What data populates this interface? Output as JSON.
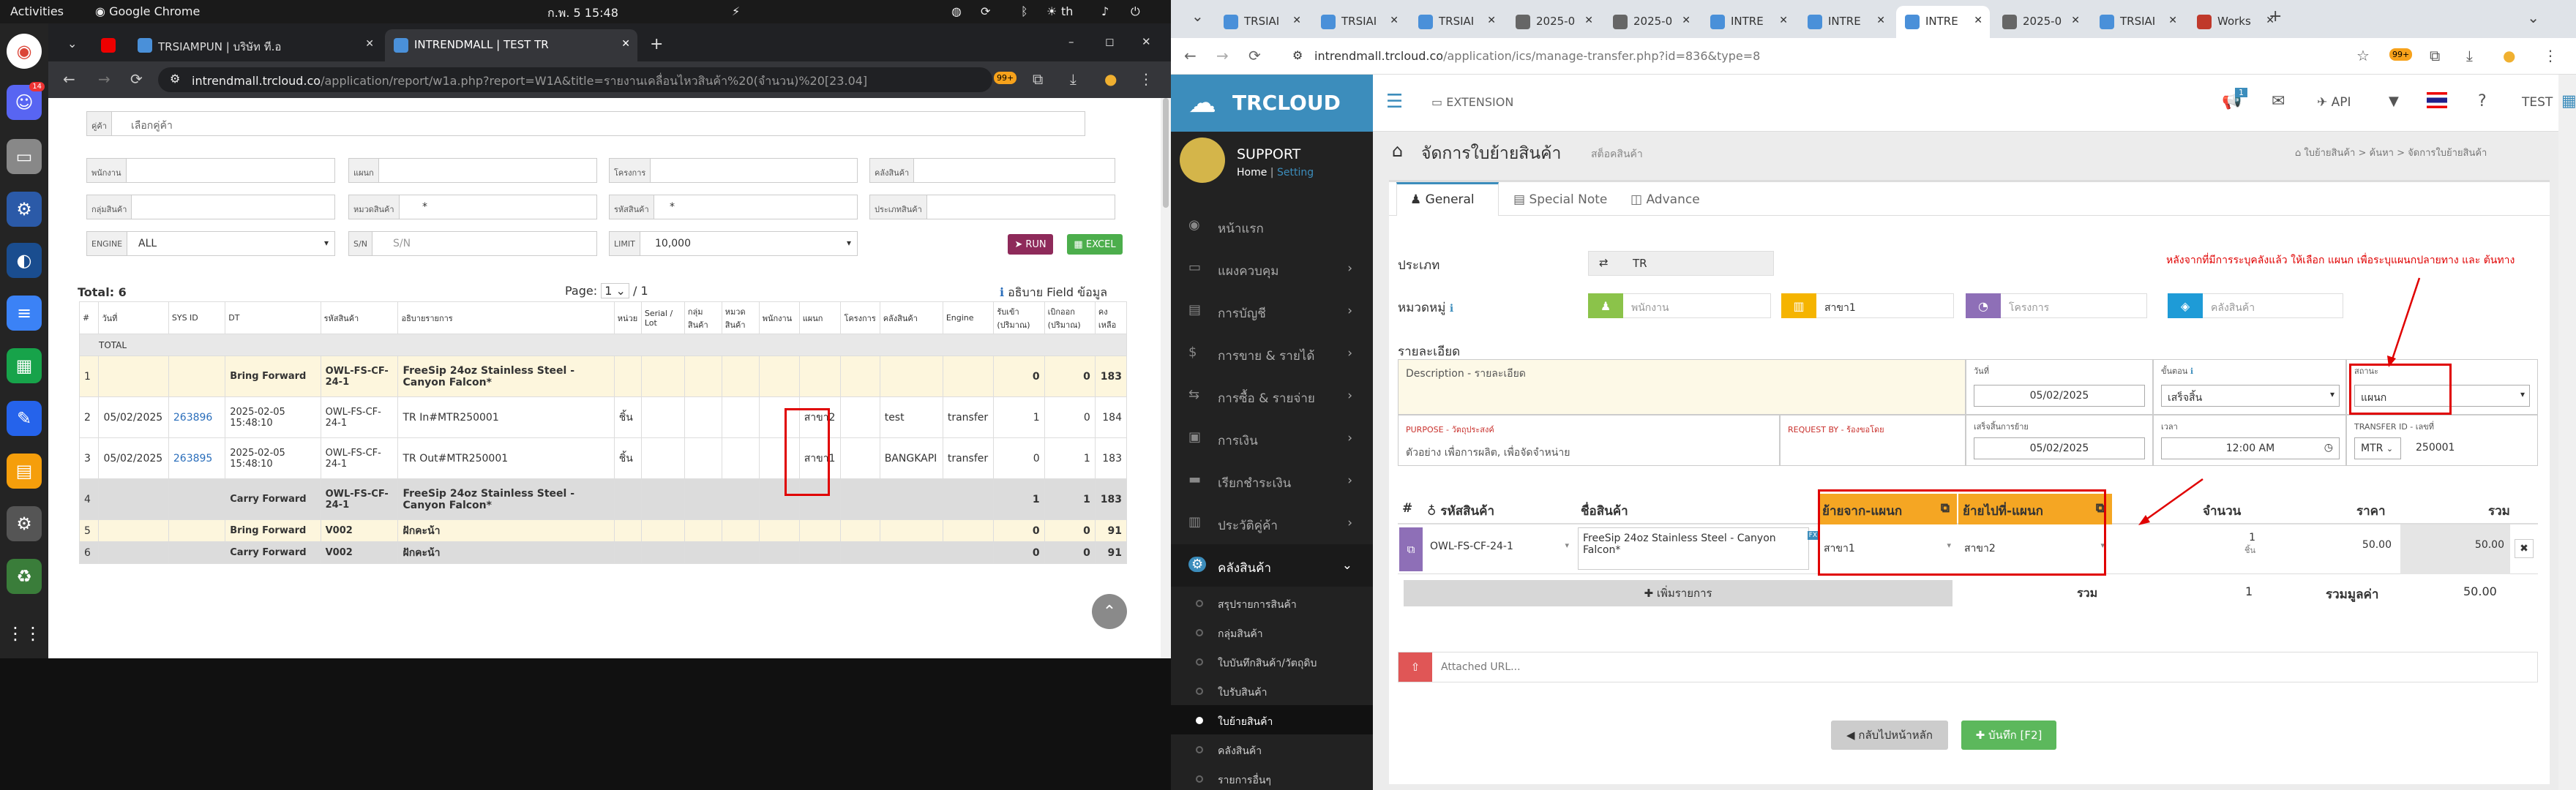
{
  "system": {
    "activities": "Activities",
    "app": "Google Chrome",
    "clock": "ก.พ. 5  15:48",
    "lang": "th",
    "dock_badge": "14"
  },
  "left": {
    "tabs": [
      {
        "label": "TRSIAMPUN | บริษัท ที.อ"
      },
      {
        "label": "INTRENDMALL | TEST TR"
      }
    ],
    "url_host": "intrendmall.trcloud.co",
    "url_path": "/application/report/w1a.php?report=W1A&title=รายงานเคลื่อนไหวสินค้า%20(จำนวน)%20[23.04]",
    "ext_badge": "99+",
    "filters": {
      "customer_label": "คู่ค้า",
      "customer_placeholder": "เลือกคู่ค้า",
      "employee": "พนักงาน",
      "department": "แผนก",
      "project": "โครงการ",
      "warehouse": "คลังสินค้า",
      "product_group": "กลุ่มสินค้า",
      "category": "หมวดสินค้า",
      "category_value": "*",
      "product_code": "รหัสสินค้า",
      "product_code_value": "*",
      "product_type": "ประเภทสินค้า",
      "engine_label": "ENGINE",
      "engine_value": "ALL",
      "sn_label": "S/N",
      "sn_placeholder": "S/N",
      "limit_label": "LIMIT",
      "limit_value": "10,000",
      "run": "RUN",
      "excel": "EXCEL"
    },
    "total": "Total: 6",
    "page_label": "Page:",
    "page_value": "1",
    "page_of": "/ 1",
    "field_desc": "อธิบาย Field ข้อมูล",
    "headers": [
      "#",
      "วันที่",
      "SYS ID",
      "DT",
      "รหัสสินค้า",
      "อธิบายรายการ",
      "หน่วย",
      "Serial / Lot",
      "กลุ่ม สินค้า",
      "หมวด สินค้า",
      "พนักงาน",
      "แผนก",
      "โครงการ",
      "คลังสินค้า",
      "Engine",
      "รับเข้า (ปริมาณ)",
      "เบิกออก (ปริมาณ)",
      "คง เหลือ"
    ],
    "total_row": "TOTAL",
    "rows": [
      {
        "n": "1",
        "date": "",
        "sys": "",
        "dt": "Bring Forward",
        "code": "OWL-FS-CF-24-1",
        "desc": "FreeSip 24oz Stainless Steel - Canyon Falcon*",
        "unit": "",
        "dept": "",
        "wh": "",
        "eng": "",
        "in": "0",
        "out": "0",
        "bal": "183",
        "style": "bf"
      },
      {
        "n": "2",
        "date": "05/02/2025",
        "sys": "263896",
        "dt": "2025-02-05 15:48:10",
        "code": "OWL-FS-CF-24-1",
        "desc": "TR In#MTR250001",
        "unit": "ชิ้น",
        "dept": "สาขา2",
        "wh": "test",
        "eng": "transfer",
        "in": "1",
        "out": "0",
        "bal": "184",
        "style": "n"
      },
      {
        "n": "3",
        "date": "05/02/2025",
        "sys": "263895",
        "dt": "2025-02-05 15:48:10",
        "code": "OWL-FS-CF-24-1",
        "desc": "TR Out#MTR250001",
        "unit": "ชิ้น",
        "dept": "สาขา1",
        "wh": "BANGKAPI",
        "eng": "transfer",
        "in": "0",
        "out": "1",
        "bal": "183",
        "style": "n"
      },
      {
        "n": "4",
        "date": "",
        "sys": "",
        "dt": "Carry Forward",
        "code": "OWL-FS-CF-24-1",
        "desc": "FreeSip 24oz Stainless Steel - Canyon Falcon*",
        "unit": "",
        "dept": "",
        "wh": "",
        "eng": "",
        "in": "1",
        "out": "1",
        "bal": "183",
        "style": "cf"
      },
      {
        "n": "5",
        "date": "",
        "sys": "",
        "dt": "Bring Forward",
        "code": "V002",
        "desc": "ฝักคะน้า",
        "unit": "",
        "dept": "",
        "wh": "",
        "eng": "",
        "in": "0",
        "out": "0",
        "bal": "91",
        "style": "bf"
      },
      {
        "n": "6",
        "date": "",
        "sys": "",
        "dt": "Carry Forward",
        "code": "V002",
        "desc": "ฝักคะน้า",
        "unit": "",
        "dept": "",
        "wh": "",
        "eng": "",
        "in": "0",
        "out": "0",
        "bal": "91",
        "style": "cf"
      }
    ]
  },
  "right": {
    "tabs": [
      "TRSIAI",
      "TRSIAI",
      "TRSIAI",
      "2025-0",
      "2025-0",
      "INTRE",
      "INTRE",
      "INTRE",
      "2025-0",
      "TRSIAI",
      "Works"
    ],
    "url_host": "intrendmall.trcloud.co",
    "url_path": "/application/ics/manage-transfer.php?id=836&type=8",
    "brand": "TRCLOUD",
    "extension": "EXTENSION",
    "notif_badge": "1",
    "api": "API",
    "user": "TEST",
    "support": "SUPPORT",
    "home": "Home",
    "setting": "Setting",
    "menu": [
      "หน้าแรก",
      "แผงควบคุม",
      "การบัญชี",
      "การขาย & รายได้",
      "การซื้อ & รายจ่าย",
      "การเงิน",
      "เรียกชำระเงิน",
      "ประวัติคู่ค้า",
      "คลังสินค้า"
    ],
    "submenu": [
      "สรุปรายการสินค้า",
      "กลุ่มสินค้า",
      "ใบบันทึกสินค้า/วัตถุดิบ",
      "ใบรับสินค้า",
      "ใบย้ายสินค้า",
      "คลังสินค้า",
      "รายการอื่นๆ"
    ],
    "title": "จัดการใบย้ายสินค้า",
    "subtitle": "สต็อคสินค้า",
    "crumbs": [
      "ใบย้ายสินค้า",
      "ค้นหา",
      "จัดการใบย้ายสินค้า"
    ],
    "tabs_inner": [
      "General",
      "Special Note",
      "Advance"
    ],
    "type_label": "ประเภท",
    "type_value": "TR",
    "annotation": "หลังจากที่มีการระบุคลังแล้ว ให้เลือก แผนก เพื่อระบุแผนกปลายทาง และ ต้นทาง",
    "cat_label": "หมวดหมู่",
    "cat_emp": "พนักงาน",
    "cat_branch": "สาขา1",
    "cat_project": "โครงการ",
    "cat_wh": "คลังสินค้า",
    "detail_label": "รายละเอียด",
    "desc_placeholder": "Description - รายละเอียด",
    "date_label": "วันที่",
    "date_value": "05/02/2025",
    "step_label": "ขั้นตอน",
    "step_value": "เสร็จสิ้น",
    "status_label": "สถานะ",
    "status_value": "แผนก",
    "purpose_label": "PURPOSE - วัตถุประสงค์",
    "purpose_text": "ตัวอย่าง เพื่อการผลิต, เพื่อจัดจำหน่าย",
    "request_label": "REQUEST BY - ร้องขอโดย",
    "done_label": "เสร็จสิ้นการย้าย",
    "done_value": "05/02/2025",
    "time_label": "เวลา",
    "time_value": "12:00 AM",
    "tid_label": "TRANSFER ID - เลขที่",
    "tid_prefix": "MTR",
    "tid_value": "250001",
    "th": [
      "#",
      "รหัสสินค้า",
      "ชื่อสินค้า",
      "ย้ายจาก-แผนก",
      "ย้ายไปที่-แผนก",
      "จำนวน",
      "ราคา",
      "รวม"
    ],
    "item": {
      "code": "OWL-FS-CF-24-1",
      "name": "FreeSip 24oz Stainless Steel - Canyon Falcon*",
      "from": "สาขา1",
      "to": "สาขา2",
      "qty": "1",
      "unit": "ชิ้น",
      "price": "50.00",
      "total": "50.00"
    },
    "add_row": "เพิ่มรายการ",
    "sum_label": "รวม",
    "sum_qty": "1",
    "sum_value_label": "รวมมูลค่า",
    "sum_value": "50.00",
    "attached": "Attached URL...",
    "back": "กลับไปหน้าหลัก",
    "save": "บันทึก [F2]"
  }
}
